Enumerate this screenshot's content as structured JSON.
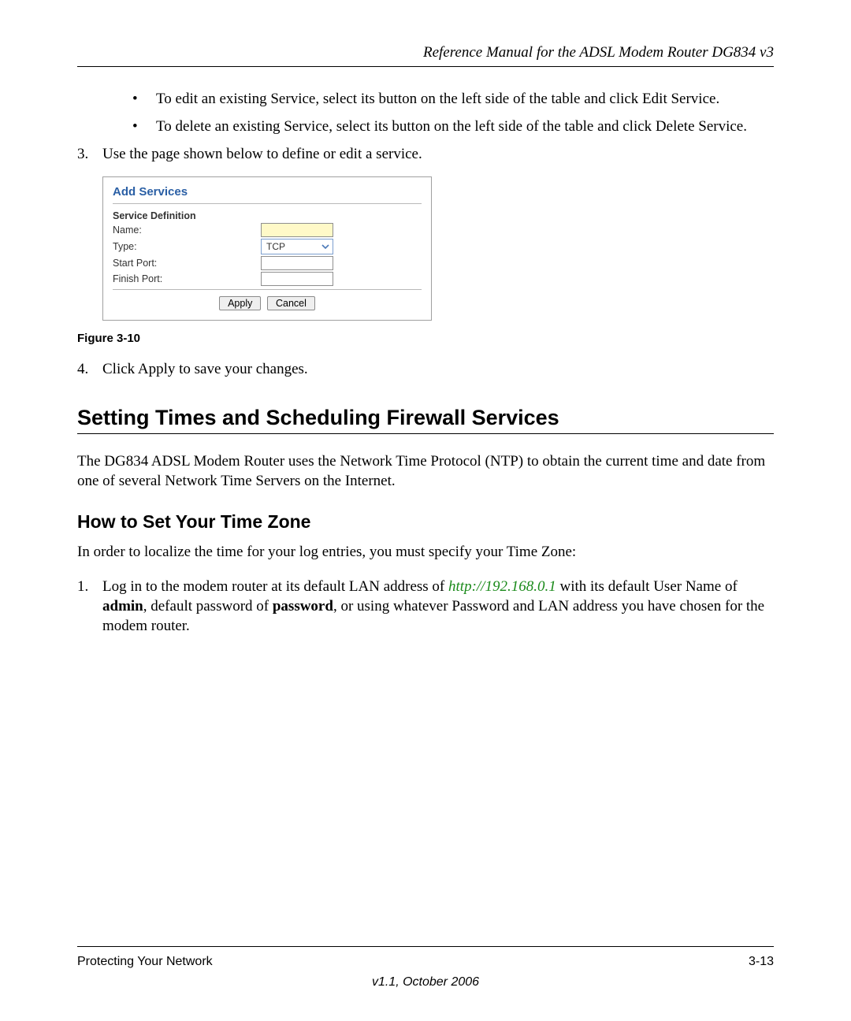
{
  "header": {
    "title": "Reference Manual for the ADSL Modem Router DG834 v3"
  },
  "bullets": [
    "To edit an existing Service, select its button on the left side of the table and click Edit Service.",
    "To delete an existing Service, select its button on the left side of the table and click Delete Service."
  ],
  "step3": {
    "num": "3.",
    "text": "Use the page shown below to define or edit a service."
  },
  "dialog": {
    "title": "Add Services",
    "section": "Service Definition",
    "rows": {
      "name_label": "Name:",
      "type_label": "Type:",
      "type_value": "TCP",
      "start_port_label": "Start Port:",
      "finish_port_label": "Finish Port:"
    },
    "buttons": {
      "apply": "Apply",
      "cancel": "Cancel"
    }
  },
  "figure_caption": "Figure 3-10",
  "step4": {
    "num": "4.",
    "text": "Click Apply to save your changes."
  },
  "h2": "Setting Times and Scheduling Firewall Services",
  "para_ntp": "The DG834 ADSL Modem Router uses the Network Time Protocol (NTP) to obtain the current time and date from one of several Network Time Servers on the Internet.",
  "h3": "How to Set Your Time Zone",
  "para_tz_intro": "In order to localize the time for your log entries, you must specify your Time Zone:",
  "step1_login": {
    "num": "1.",
    "pre": "Log in to the modem router at its default LAN address of ",
    "link": "http://192.168.0.1",
    "mid1": " with its default User Name of ",
    "bold1": "admin",
    "mid2": ", default password of ",
    "bold2": "password",
    "post": ", or using whatever Password and LAN address you have chosen for the modem router."
  },
  "footer": {
    "left": "Protecting Your Network",
    "right": "3-13",
    "version": "v1.1, October 2006"
  }
}
